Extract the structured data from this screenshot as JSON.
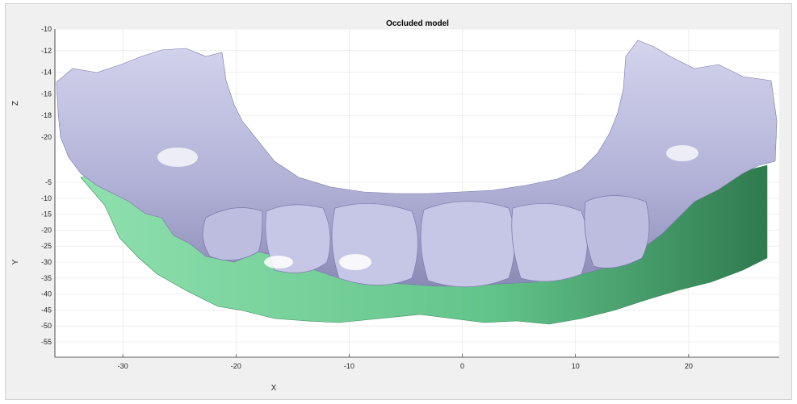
{
  "chart_data": {
    "type": "surface",
    "title": "Occluded model",
    "xlabel": "X",
    "ylabel": "Y",
    "zlabel": "Z",
    "xlim": [
      -36,
      28
    ],
    "x_ticks": [
      -30,
      -20,
      -10,
      0,
      10,
      20
    ],
    "z_ticks": [
      -10,
      -12,
      -14,
      -16,
      -18,
      -20
    ],
    "y_ticks": [
      -5,
      -10,
      -15,
      -20,
      -25,
      -30,
      -35,
      -40,
      -45,
      -50,
      -55
    ],
    "grid": true,
    "series": [
      {
        "name": "",
        "color": "#b8b8dc"
      },
      {
        "name": "",
        "color": "#7fd8a0"
      }
    ]
  },
  "colors": {
    "upper_surface": "#b8b8dc",
    "upper_shadow": "#6f6f99",
    "lower_surface": "#7fd8a0",
    "lower_shadow": "#2f6e46",
    "axes_background": "#ffffff",
    "figure_background": "#f0f0f0",
    "grid": "#e3e3e3"
  }
}
